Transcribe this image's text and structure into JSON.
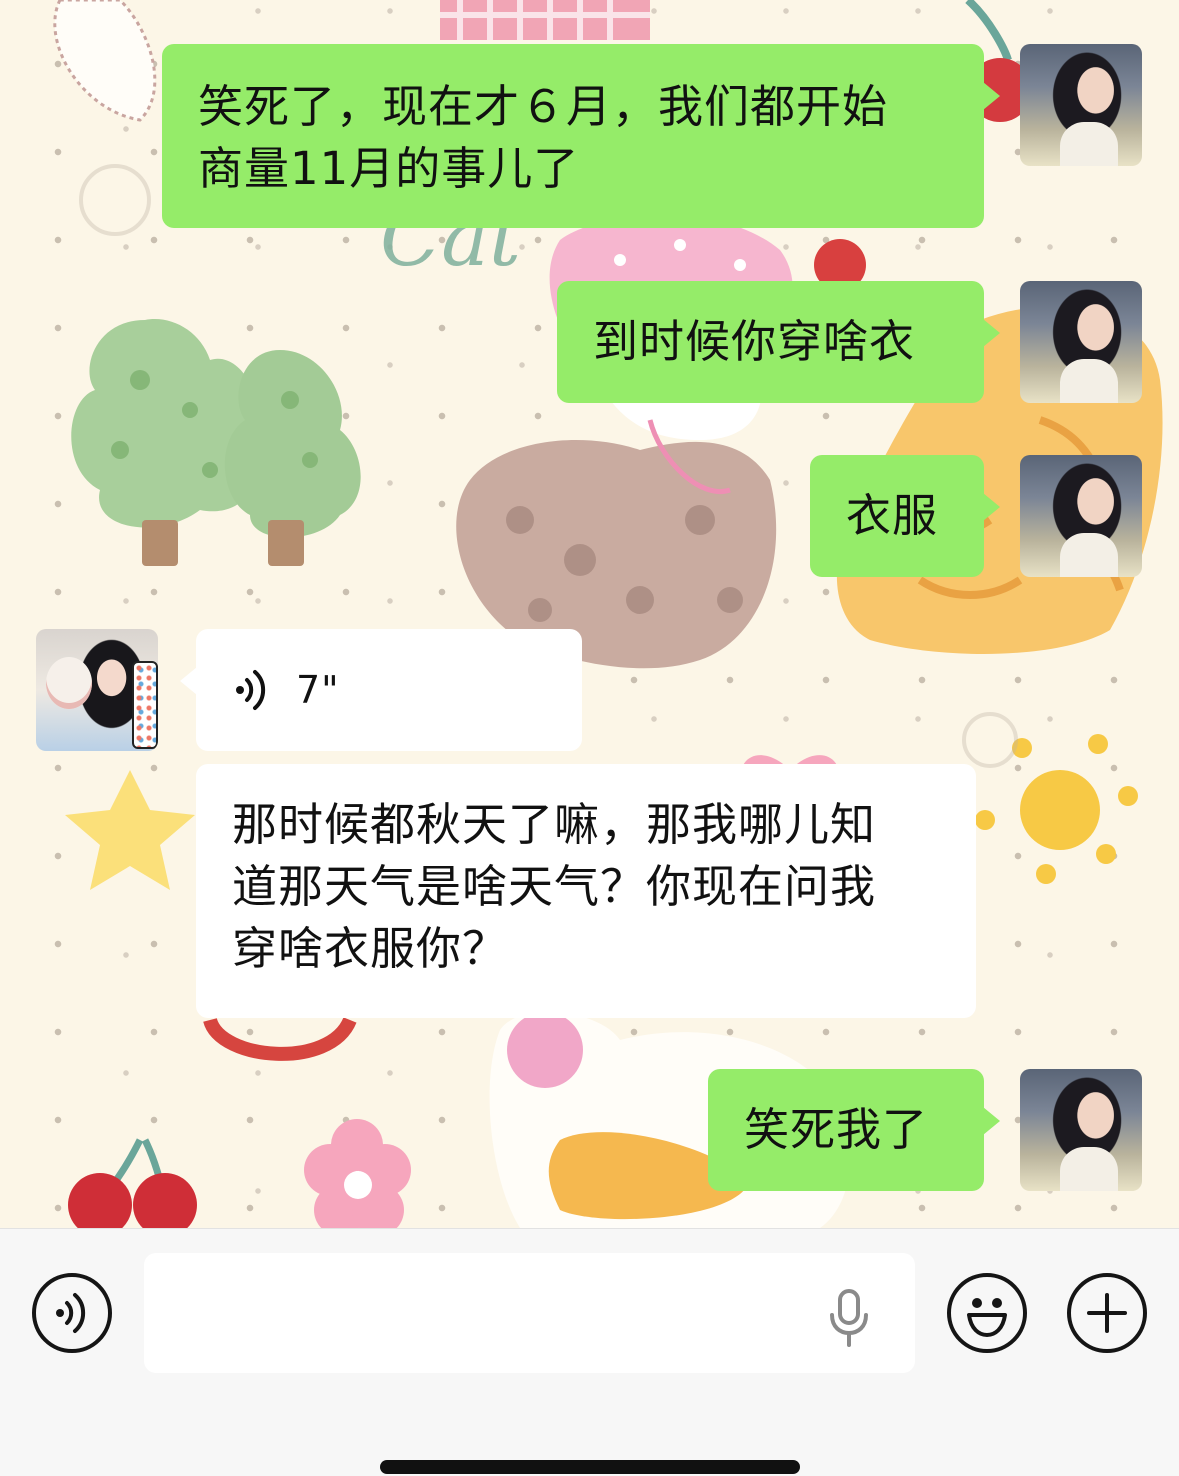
{
  "messages": [
    {
      "id": 1,
      "sender": "me",
      "type": "text",
      "text_lines": [
        "笑死了，现在才６月，我们都开始",
        "商量11月的事儿了"
      ]
    },
    {
      "id": 2,
      "sender": "me",
      "type": "text",
      "text": "到时候你穿啥衣"
    },
    {
      "id": 3,
      "sender": "me",
      "type": "text",
      "text": "衣服"
    },
    {
      "id": 4,
      "sender": "friend",
      "type": "voice",
      "duration": "7\""
    },
    {
      "id": 5,
      "sender": "friend",
      "type": "text",
      "text_lines": [
        "那时候都秋天了嘛，那我哪儿知",
        "道那天气是啥天气？你现在问我",
        "穿啥衣服你？"
      ]
    },
    {
      "id": 6,
      "sender": "me",
      "type": "text",
      "text": "笑死我了"
    }
  ],
  "input_bar": {
    "voice_toggle_icon": "voice-icon",
    "text_value": "",
    "mic_icon": "microphone-icon",
    "emoji_icon": "smiley-icon",
    "more_icon": "plus-icon"
  },
  "wallpaper_text": [
    "Cat"
  ],
  "colors": {
    "outgoing_bubble": "#95ec69",
    "incoming_bubble": "#ffffff",
    "input_bar_bg": "#f7f7f7",
    "wallpaper_bg": "#fcf6e7"
  }
}
